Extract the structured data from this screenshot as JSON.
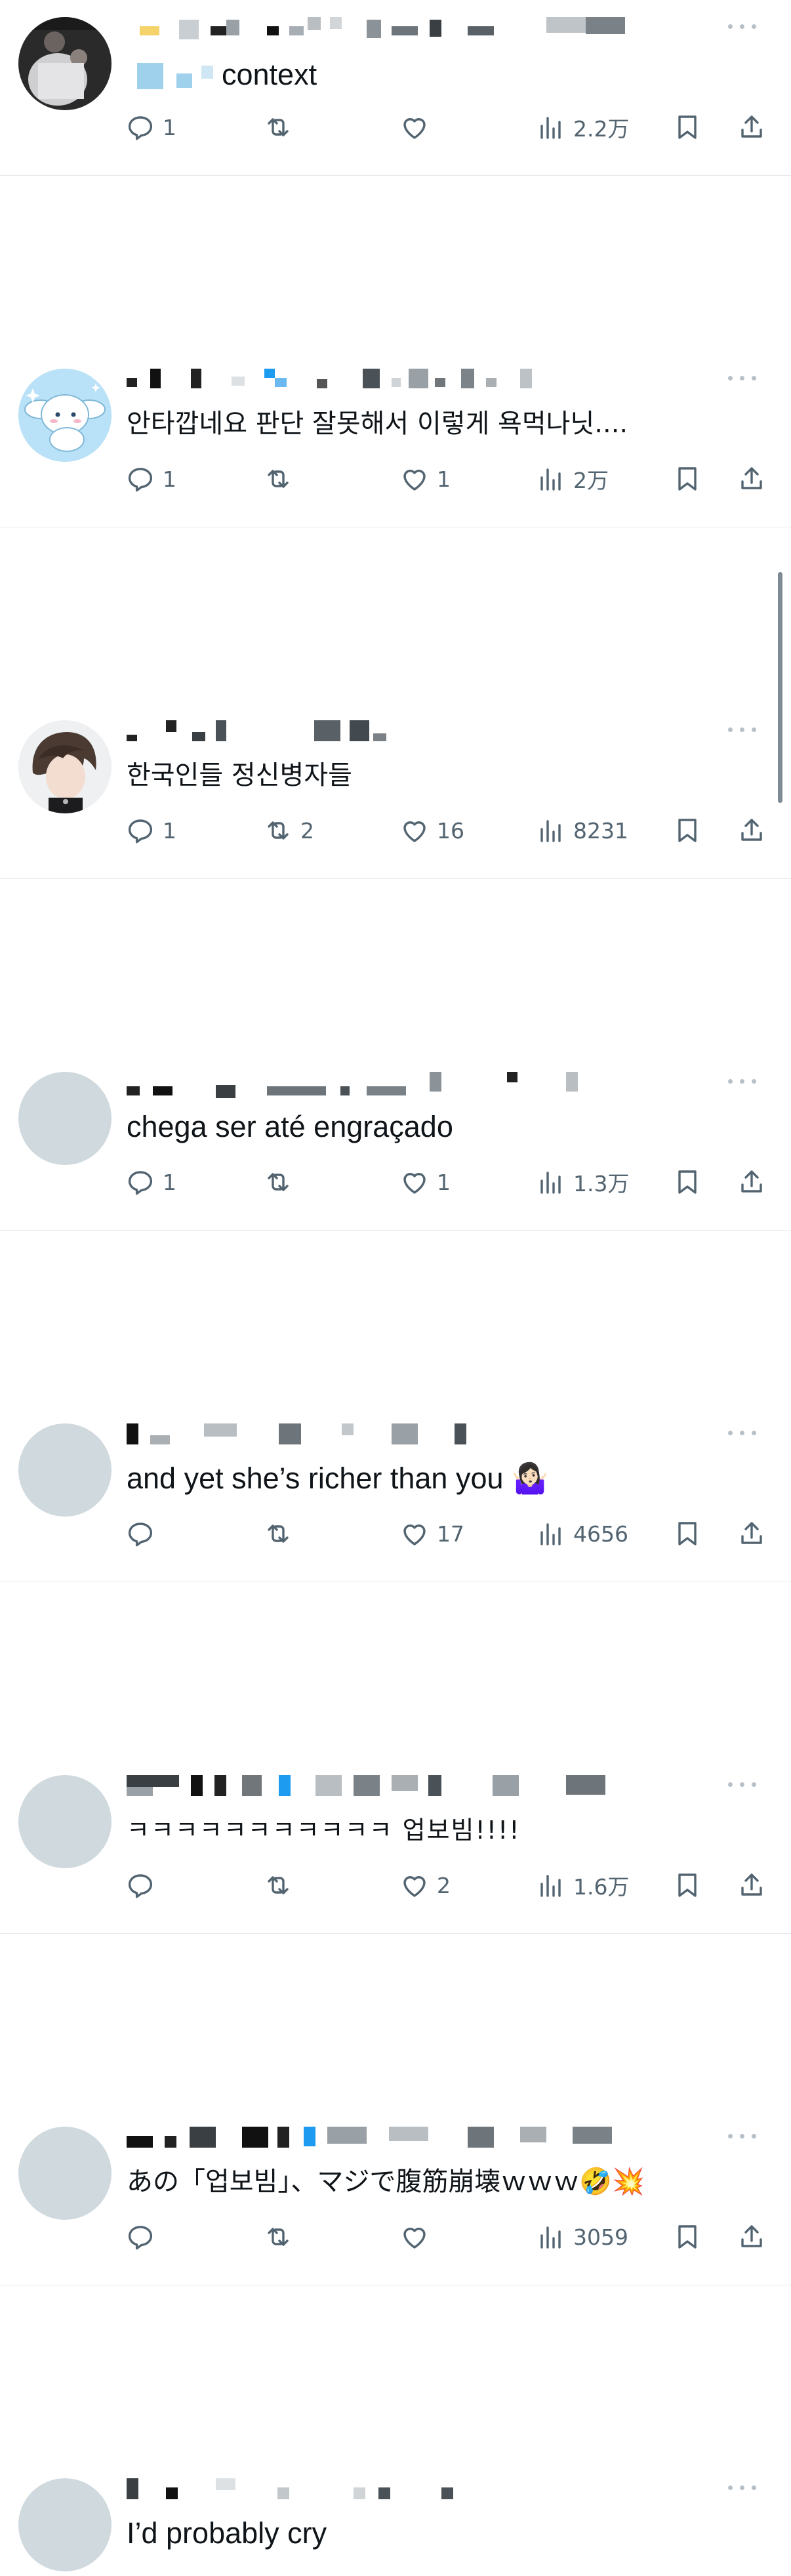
{
  "replies": [
    {
      "text": "context",
      "reply_count": "1",
      "repost_count": "",
      "like_count": "",
      "view_count": "2.2万",
      "avatar": "photo-performer"
    },
    {
      "text": "안타깝네요 판단 잘못해서 이렇게 욕먹나닛....",
      "reply_count": "1",
      "repost_count": "",
      "like_count": "1",
      "view_count": "2万",
      "avatar": "cartoon-dog"
    },
    {
      "text": "한국인들 정신병자들",
      "reply_count": "1",
      "repost_count": "2",
      "like_count": "16",
      "view_count": "8231",
      "avatar": "anime-character"
    },
    {
      "text": "chega ser até engraçado",
      "reply_count": "1",
      "repost_count": "",
      "like_count": "1",
      "view_count": "1.3万",
      "avatar": "default"
    },
    {
      "text": "and yet she’s richer than you 🤷🏻‍♀️",
      "reply_count": "",
      "repost_count": "",
      "like_count": "17",
      "view_count": "4656",
      "avatar": "default"
    },
    {
      "text": "ㅋㅋㅋㅋㅋㅋㅋㅋㅋㅋㅋ 업보빔!!!!",
      "reply_count": "",
      "repost_count": "",
      "like_count": "2",
      "view_count": "1.6万",
      "avatar": "default"
    },
    {
      "text": "あの「업보빔」、マジで腹筋崩壊ｗｗｗ🤣💥",
      "reply_count": "",
      "repost_count": "",
      "like_count": "",
      "view_count": "3059",
      "avatar": "default"
    },
    {
      "text": "I’d probably cry",
      "reply_count": "",
      "repost_count": "",
      "like_count": "",
      "view_count": "",
      "avatar": "default"
    }
  ],
  "colors": {
    "icon": "#536471",
    "divider": "#e6e9ec",
    "avatar_placeholder": "#cfd9de",
    "text": "#0f1419"
  }
}
